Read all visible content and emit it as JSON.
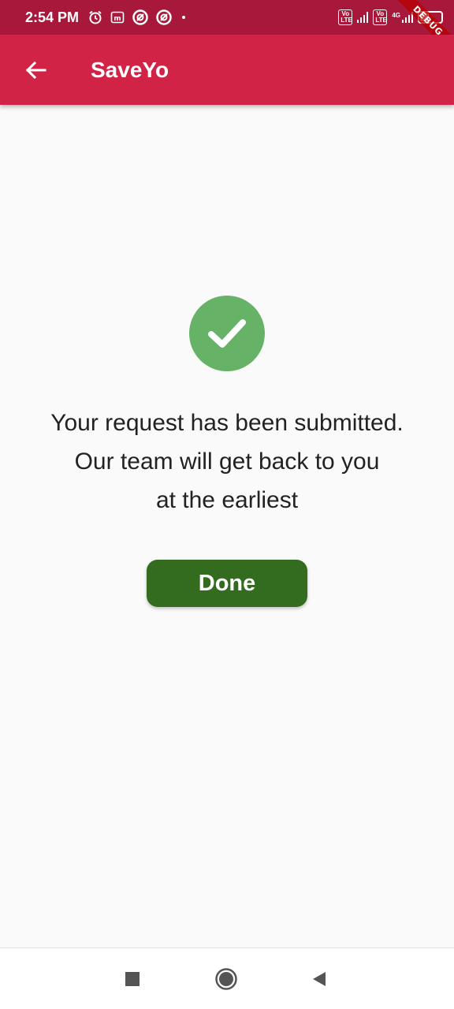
{
  "status_bar": {
    "time": "2:54 PM",
    "left_icons": [
      "alarm-icon",
      "m-app-icon",
      "app-icon",
      "app-icon",
      "dot-icon"
    ],
    "right_icons": [
      "volte-icon",
      "signal-icon",
      "volte-icon",
      "4g-signal-icon",
      "battery-icon"
    ],
    "volte_label": "Vo\nLTE",
    "network_label": "4G",
    "battery_label": "11"
  },
  "debug_banner": "DEBUG",
  "app_bar": {
    "title": "SaveYo",
    "back_icon": "arrow-left-icon",
    "color": "#d12345"
  },
  "main": {
    "success_icon": "check-circle-icon",
    "success_color": "#66b266",
    "message_lines": [
      "Your request has been submitted.",
      "Our team will get back to you",
      "at the earliest"
    ],
    "done_label": "Done",
    "done_color": "#336b1f"
  },
  "nav_bar": {
    "buttons": [
      "recents-square-icon",
      "home-circle-icon",
      "back-triangle-icon"
    ]
  }
}
